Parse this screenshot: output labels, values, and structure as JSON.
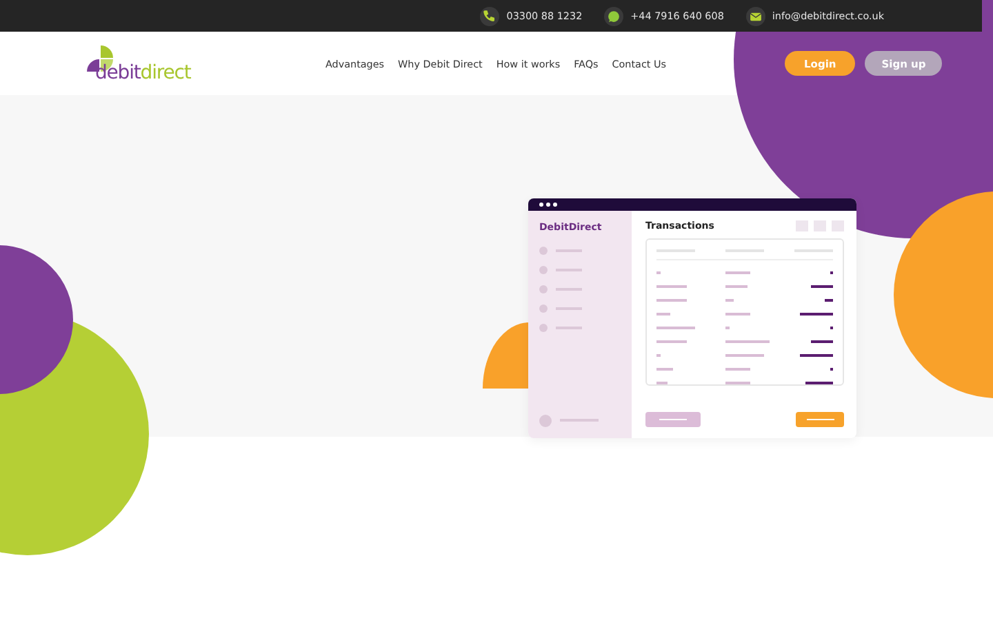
{
  "top_bar": {
    "contacts": [
      {
        "kind": "phone",
        "text": "03300 88 1232"
      },
      {
        "kind": "whatsapp",
        "text": "+44 7916 640 608"
      },
      {
        "kind": "email",
        "text": "info@debitdirect.co.uk"
      }
    ]
  },
  "header": {
    "logo": {
      "words": [
        "debit",
        "direct"
      ]
    },
    "nav": [
      "Advantages",
      "Why Debit Direct",
      "How it works",
      "FAQs",
      "Contact Us"
    ],
    "buttons": [
      {
        "kind": "primary",
        "label": "Login"
      },
      {
        "kind": "secondary",
        "label": "Sign up"
      }
    ]
  },
  "mockup": {
    "brand": "DebitDirect",
    "title": "Transactions"
  }
}
